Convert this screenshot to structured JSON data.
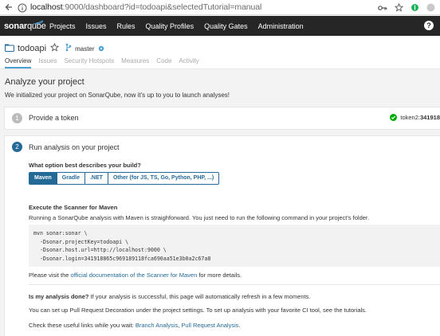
{
  "browser": {
    "url_host": "localhost",
    "url_rest": ":9000/dashboard?id=todoapi&selectedTutorial=manual"
  },
  "nav": {
    "logo_bold": "sonar",
    "logo_light": "qube",
    "items": [
      "Projects",
      "Issues",
      "Rules",
      "Quality Profiles",
      "Quality Gates",
      "Administration"
    ],
    "help": "?"
  },
  "project": {
    "name": "todoapi",
    "branch": "master",
    "tabs": [
      "Overview",
      "Issues",
      "Security Hotspots",
      "Measures",
      "Code",
      "Activity"
    ]
  },
  "page": {
    "title": "Analyze your project",
    "subtitle": "We initialized your project on SonarQube, now it's up to you to launch analyses!"
  },
  "step1": {
    "number": "1",
    "title": "Provide a token",
    "token_label": "token2: ",
    "token_value": "341918"
  },
  "step2": {
    "number": "2",
    "title": "Run analysis on your project",
    "question": "What option best describes your build?",
    "options": [
      "Maven",
      "Gradle",
      ".NET",
      "Other (for JS, TS, Go, Python, PHP, ...)"
    ],
    "selected": "Maven",
    "exec_title": "Execute the Scanner for Maven",
    "exec_desc": "Running a SonarQube analysis with Maven is straighforward. You just need to run the following command in your project's folder.",
    "code": [
      "mvn sonar:sonar \\",
      "  -Dsonar.projectKey=todoapi \\",
      "  -Dsonar.host.url=http://localhost:9000 \\",
      "  -Dsonar.login=341918865c969189118fca690aa51e3b0a2c67a8"
    ],
    "visit_pre": "Please visit the ",
    "visit_link": "official documentation of the Scanner for Maven",
    "visit_post": " for more details.",
    "done_bold": "Is my analysis done?",
    "done_rest": " If your analysis is successful, this page will automatically refresh in a few moments.",
    "pr_text": "You can set up Pull Request Decoration under the project settings. To set up analysis with your favorite CI tool, see the tutorials.",
    "check_pre": "Check these useful links while you wait: ",
    "link1": "Branch Analysis",
    "sep": ", ",
    "link2": "Pull Request Analysis",
    "check_post": "."
  },
  "colors": {
    "nav_bg": "#262626",
    "accent": "#236a97",
    "tab_underline": "#4b9fd5",
    "success": "#00aa00"
  }
}
